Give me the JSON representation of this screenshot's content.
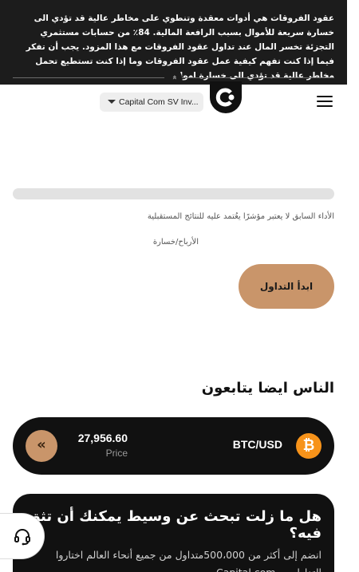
{
  "risk_warning": {
    "text": "عقود الفروقات هي أدوات معقدة وتنطوي على مخاطر عالية قد تؤدي الى خسارة سريعة للأموال بسبب الرافعة المالية. 84٪ من حسابات مستثمري التجزئة تخسر المال عند تداول عقود الفروقات مع هذا المزود. يجب أن تفكر فيما إذا كنت تفهم كيفية عمل عقود الفروقات وما إذا كنت تستطيع تحمل مخاطر عالية قد تؤدي الى خسارة اموالك.",
    "collapse_icon": "«"
  },
  "header": {
    "entity_select": "Capital Com SV Inv...",
    "menu_icon": "hamburger-icon",
    "logo_icon": "capital-com-logo"
  },
  "chart_area": {
    "disclaimer": "الأداء السابق لا يعتبر مؤشرًا يعُتمد عليه للنتائج المستقبلية",
    "pl_label": "الأرباح/خسارة"
  },
  "cta": {
    "start_trading": "ابدأ التداول"
  },
  "people_follow": {
    "title": "الناس ايضا يتابعون",
    "item": {
      "icon_letter": "₿",
      "pair": "BTC/USD",
      "price": "27,956.60",
      "price_label": "Price",
      "expand_icon": "«"
    }
  },
  "promo": {
    "title": "هل ما زلت تبحث عن وسيط يمكنك أن تثق فيه؟",
    "text": "انضم إلى أكثر من 500،000متداول من جميع أنحاء العالم اختاروا التداول مع Capital.com"
  },
  "colors": {
    "banner_bg": "#1c1c1c",
    "accent": "#c9956a",
    "btc": "#f7931a",
    "card_bg": "#111111"
  },
  "support": {
    "icon": "headset-icon"
  }
}
